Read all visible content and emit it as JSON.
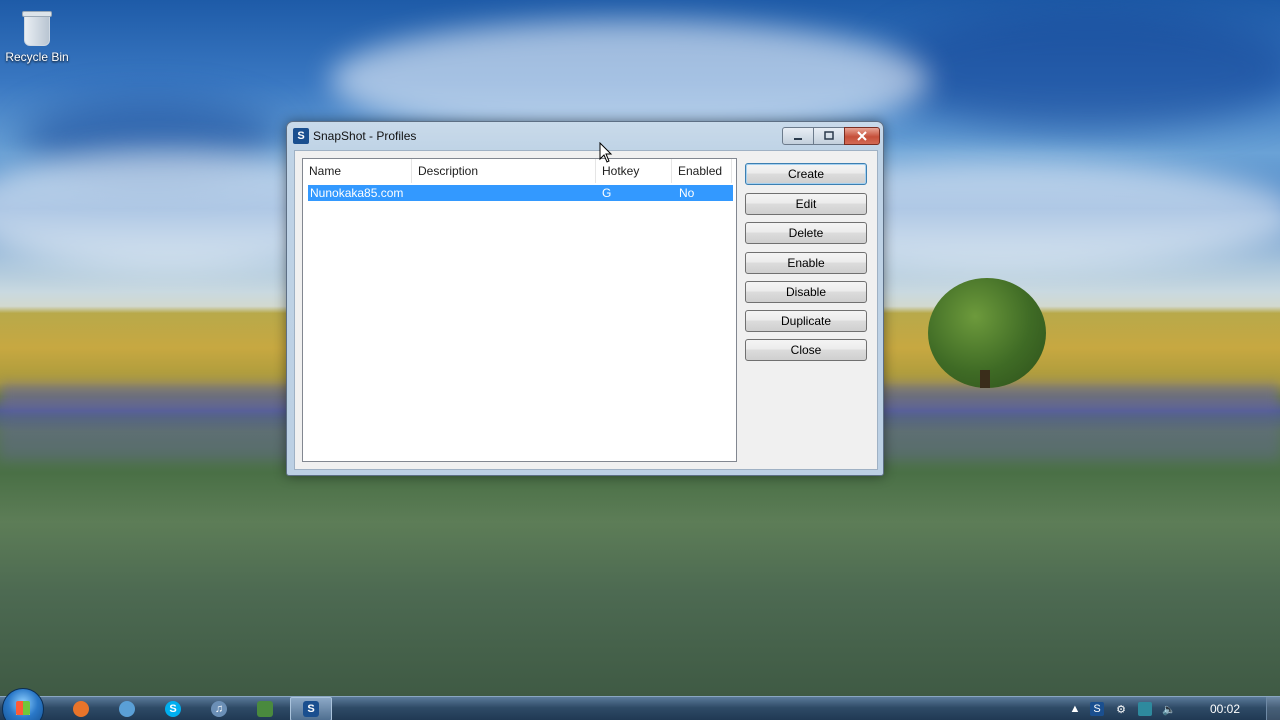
{
  "desktop": {
    "icons": [
      {
        "label": "Recycle Bin",
        "icon": "recycle-bin-icon"
      }
    ]
  },
  "window": {
    "title": "SnapShot - Profiles",
    "app_icon_letter": "S",
    "controls": {
      "minimize": "minimize-icon",
      "maximize": "maximize-icon",
      "close": "close-icon"
    },
    "list": {
      "columns": [
        "Name",
        "Description",
        "Hotkey",
        "Enabled"
      ],
      "rows": [
        {
          "name": "Nunokaka85.com",
          "description": "",
          "hotkey": "G",
          "enabled": "No",
          "selected": true
        }
      ]
    },
    "buttons": [
      "Create",
      "Edit",
      "Delete",
      "Enable",
      "Disable",
      "Duplicate",
      "Close"
    ]
  },
  "taskbar": {
    "start": "windows-start-icon",
    "pinned": [
      {
        "name": "firefox-icon",
        "color": "#e8742a"
      },
      {
        "name": "network-users-icon",
        "color": "#5a9fd6"
      },
      {
        "name": "skype-icon",
        "color": "#00aff0"
      },
      {
        "name": "itunes-icon",
        "color": "#6b8fb6"
      },
      {
        "name": "video-editor-icon",
        "color": "#4a8a3e"
      },
      {
        "name": "snapshot-icon",
        "color": "#1a4f8f",
        "letter": "S",
        "active": true
      }
    ],
    "tray": [
      "show-hidden-icons-icon",
      "snapshot-tray-icon",
      "tools-tray-icon",
      "network-tray-icon",
      "flag-tray-icon",
      "volume-icon"
    ],
    "clock": "00:02"
  }
}
